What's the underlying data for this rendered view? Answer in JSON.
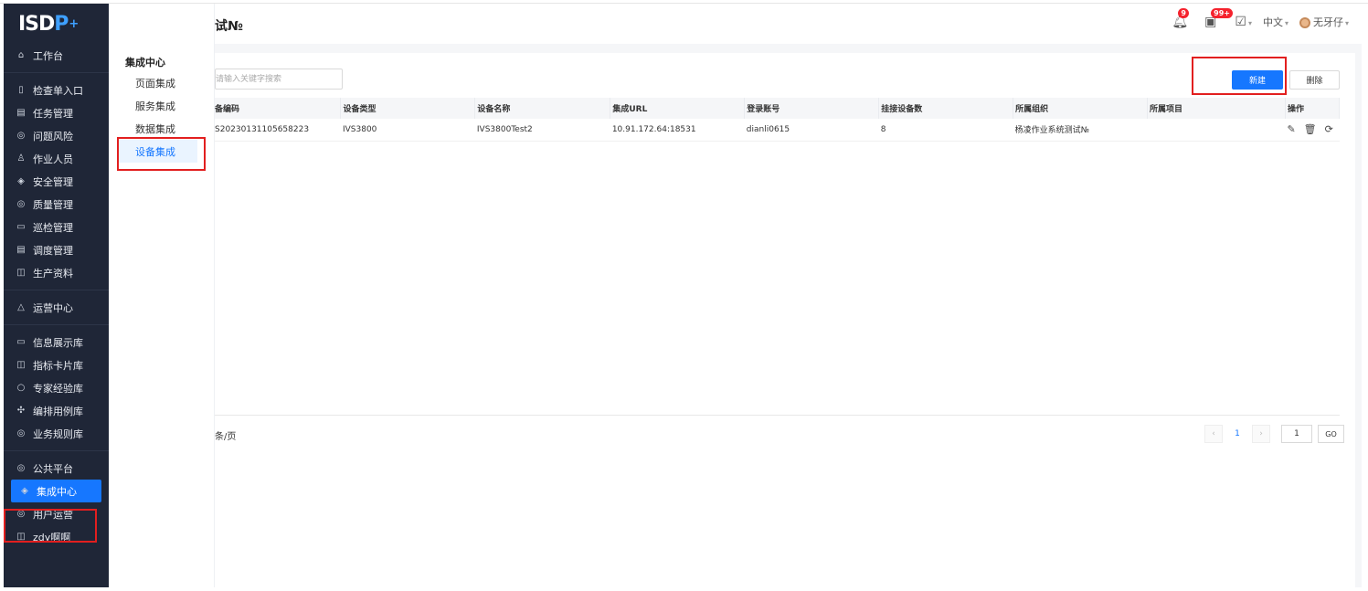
{
  "logo": {
    "text_main": "ISD",
    "text_p": "P",
    "text_plus": "+"
  },
  "sidebar": {
    "items": [
      {
        "icon": "home-icon",
        "glyph": "⌂",
        "label": "工作台"
      },
      {
        "sep": true
      },
      {
        "icon": "checklist-icon",
        "glyph": "▯",
        "label": "检查单入口"
      },
      {
        "icon": "task-icon",
        "glyph": "▤",
        "label": "任务管理"
      },
      {
        "icon": "risk-icon",
        "glyph": "◎",
        "label": "问题风险"
      },
      {
        "icon": "people-icon",
        "glyph": "♙",
        "label": "作业人员"
      },
      {
        "icon": "shield-icon",
        "glyph": "◈",
        "label": "安全管理"
      },
      {
        "icon": "quality-icon",
        "glyph": "◎",
        "label": "质量管理"
      },
      {
        "icon": "inspect-icon",
        "glyph": "▭",
        "label": "巡检管理"
      },
      {
        "icon": "schedule-icon",
        "glyph": "▤",
        "label": "调度管理"
      },
      {
        "icon": "doc-icon",
        "glyph": "◫",
        "label": "生产资料"
      },
      {
        "sep": true
      },
      {
        "icon": "ops-icon",
        "glyph": "△",
        "label": "运营中心"
      },
      {
        "sep": true
      },
      {
        "icon": "info-icon",
        "glyph": "▭",
        "label": "信息展示库"
      },
      {
        "icon": "card-icon",
        "glyph": "◫",
        "label": "指标卡片库"
      },
      {
        "icon": "expert-icon",
        "glyph": "○",
        "label": "专家经验库"
      },
      {
        "icon": "case-icon",
        "glyph": "✣",
        "label": "编排用例库"
      },
      {
        "icon": "rule-icon",
        "glyph": "◎",
        "label": "业务规则库"
      },
      {
        "sep": true
      },
      {
        "icon": "platform-icon",
        "glyph": "◎",
        "label": "公共平台"
      },
      {
        "icon": "integration-icon",
        "glyph": "◈",
        "label": "集成中心",
        "active": true
      },
      {
        "icon": "user-ops-icon",
        "glyph": "◎",
        "label": "用户运营"
      },
      {
        "icon": "custom-icon",
        "glyph": "◫",
        "label": "zdy啊啊"
      }
    ]
  },
  "subpanel": {
    "title": "集成中心",
    "items": [
      {
        "label": "页面集成"
      },
      {
        "label": "服务集成"
      },
      {
        "label": "数据集成"
      },
      {
        "label": "设备集成",
        "active": true
      }
    ]
  },
  "header": {
    "title": "试№",
    "notify_badge": "9",
    "msg_badge": "99+",
    "lang": "中文",
    "user": "无牙仔"
  },
  "toolbar": {
    "search_placeholder": "请输入关键字搜索",
    "new_label": "新建",
    "delete_label": "删除"
  },
  "table": {
    "columns": [
      "备编码",
      "设备类型",
      "设备名称",
      "集成URL",
      "登录账号",
      "挂接设备数",
      "所属组织",
      "所属项目",
      "操作"
    ],
    "rows": [
      [
        "S20230131105658223",
        "IVS3800",
        "IVS3800Test2",
        "10.91.172.64:18531",
        "dianli0615",
        "8",
        "杨凌作业系统测试№",
        ""
      ]
    ]
  },
  "pagination": {
    "page_size_text": "条/页",
    "current_page": "1",
    "jump_value": "1",
    "go_label": "GO",
    "prev": "‹",
    "next": "›"
  },
  "colors": {
    "primary": "#1677ff",
    "sidebar_bg": "#1f2637",
    "highlight": "#e21f1f",
    "badge": "#f5222d"
  }
}
